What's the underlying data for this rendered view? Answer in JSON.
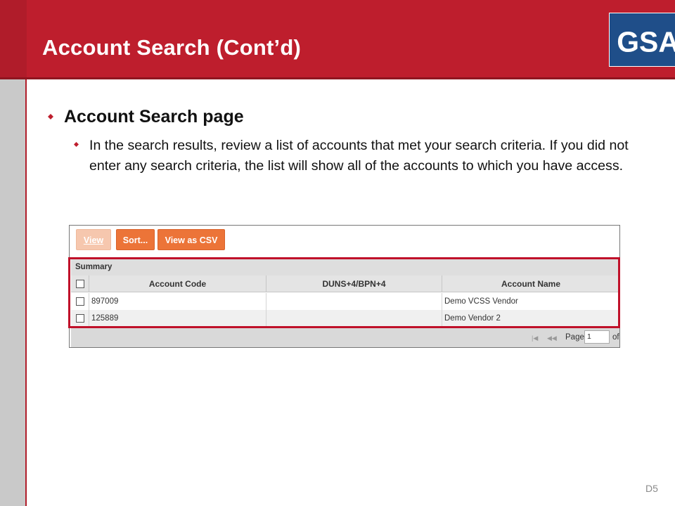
{
  "slide": {
    "title": "Account Search (Cont’d)",
    "logo_text": "GSA",
    "logo_mark": "®",
    "slide_number": "D5",
    "colors": {
      "header_red": "#be1e2d",
      "logo_blue": "#1f4e89",
      "button_orange": "#ec7438",
      "highlight_red": "#c0112a"
    }
  },
  "bullets": {
    "level1": "Account Search page",
    "level2": "In the search results, review a list of accounts that met your search criteria. If you did not enter any search criteria, the list will show all of the accounts to which you have access."
  },
  "app": {
    "toolbar": {
      "view_label": "View",
      "sort_label": "Sort...",
      "csv_label": "View as CSV"
    },
    "summary_label": "Summary",
    "columns": [
      "Account Code",
      "DUNS+4/BPN+4",
      "Account Name"
    ],
    "rows": [
      {
        "account_code": "897009",
        "duns": "",
        "account_name": "Demo VCSS Vendor"
      },
      {
        "account_code": "125889",
        "duns": "",
        "account_name": "Demo Vendor 2"
      }
    ],
    "pager": {
      "first_icon": "first-page-icon",
      "prev_icon": "prev-page-icon",
      "page_label": "Page",
      "page_value": "1",
      "of_label": "of"
    }
  }
}
